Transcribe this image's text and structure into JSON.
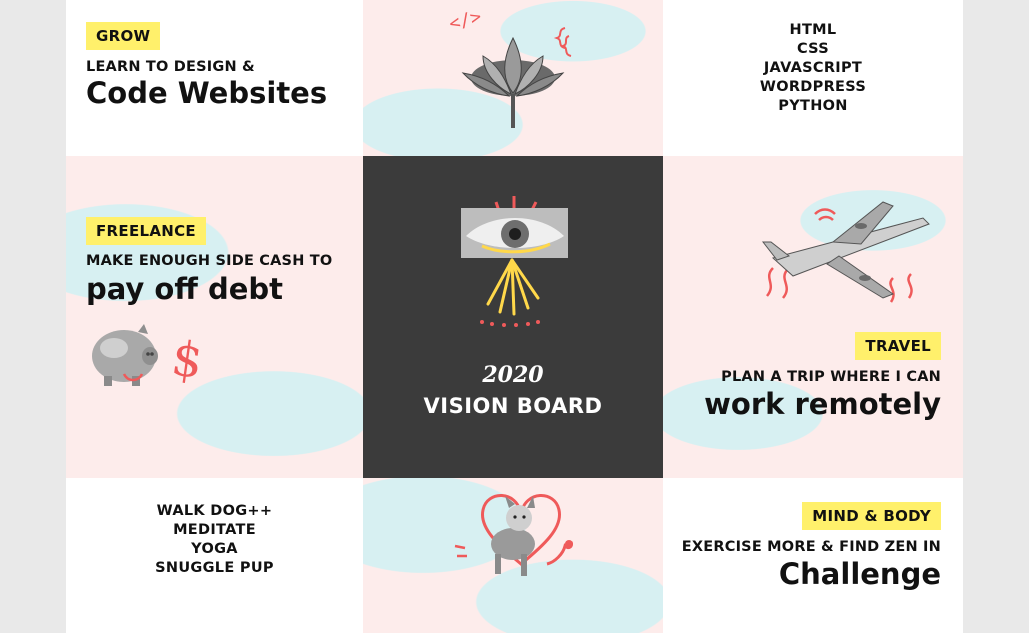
{
  "grow": {
    "tag": "GROW",
    "lead": "LEARN TO DESIGN &",
    "headline": "Code Websites"
  },
  "skills": [
    "HTML",
    "CSS",
    "JAVASCRIPT",
    "WORDPRESS",
    "PYTHON"
  ],
  "freelance": {
    "tag": "FREELANCE",
    "lead": "MAKE ENOUGH SIDE CASH TO",
    "headline": "pay off debt"
  },
  "center": {
    "year": "2020",
    "title": "VISION BOARD"
  },
  "travel": {
    "tag": "TRAVEL",
    "lead": "PLAN A TRIP WHERE I CAN",
    "headline": "work remotely"
  },
  "routine": [
    "WALK DOG++",
    "MEDITATE",
    "YOGA",
    "SNUGGLE PUP"
  ],
  "mind_body": {
    "tag": "MIND & BODY",
    "lead": "EXERCISE MORE & FIND ZEN IN",
    "headline": "Challenge"
  },
  "icons": {
    "code_scribble": "</>",
    "dollar_scribble": "$"
  },
  "colors": {
    "tag_yellow": "#fff06b",
    "accent_red": "#ef5a5a",
    "center_dark": "#3b3b3b",
    "paint_blue": "#d7f0f2",
    "paint_pink": "#fdeceb"
  }
}
